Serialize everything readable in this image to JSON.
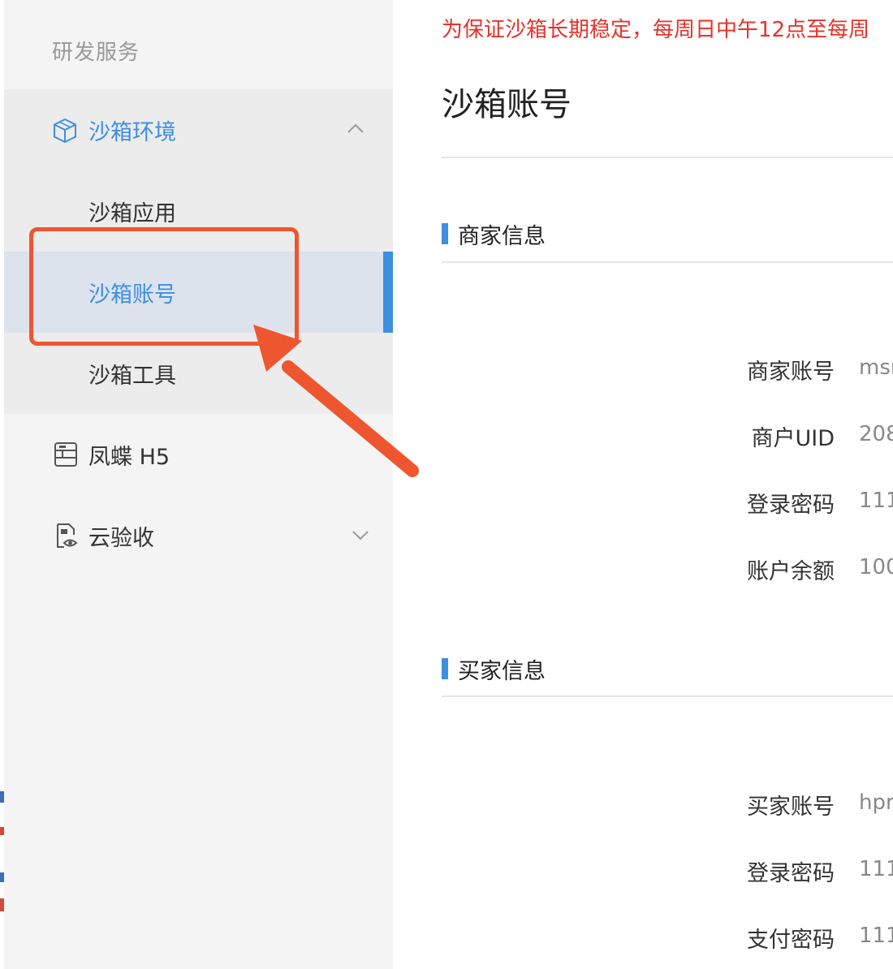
{
  "sidebar": {
    "section_title": "研发服务",
    "items": [
      {
        "label": "沙箱环境",
        "icon": "cube-icon",
        "expanded": true
      },
      {
        "label": "沙箱应用"
      },
      {
        "label": "沙箱账号",
        "active": true
      },
      {
        "label": "沙箱工具"
      },
      {
        "label": "凤蝶 H5",
        "icon": "layout-icon"
      },
      {
        "label": "云验收",
        "icon": "doc-eye-icon",
        "expanded": false
      }
    ]
  },
  "main": {
    "notice": "为保证沙箱长期稳定，每周日中午12点至每周",
    "title": "沙箱账号",
    "merchant": {
      "heading": "商家信息",
      "fields": [
        {
          "key": "商家账号",
          "value": "msr"
        },
        {
          "key": "商户UID",
          "value": "208"
        },
        {
          "key": "登录密码",
          "value": "111"
        },
        {
          "key": "账户余额",
          "value": "100"
        }
      ]
    },
    "buyer": {
      "heading": "买家信息",
      "fields": [
        {
          "key": "买家账号",
          "value": "hpr"
        },
        {
          "key": "登录密码",
          "value": "111"
        },
        {
          "key": "支付密码",
          "value": "111"
        }
      ]
    }
  },
  "colors": {
    "accent": "#3d8fe0",
    "notice": "#e8322a",
    "annotation": "#ee5630",
    "sidebar_bg": "#f4f4f4",
    "active_bg": "#dde3ec"
  }
}
